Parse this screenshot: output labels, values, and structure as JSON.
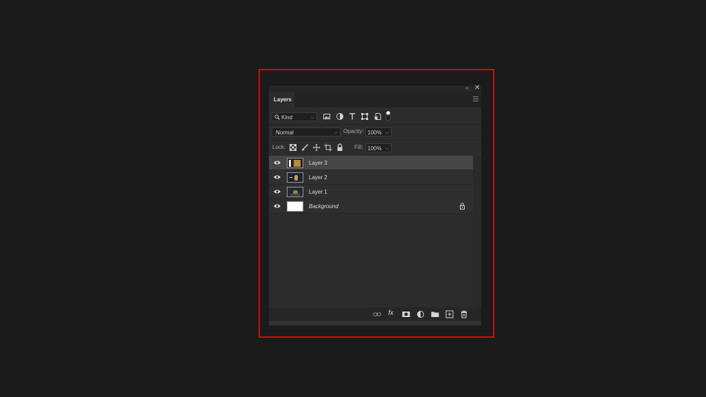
{
  "panel": {
    "tab_label": "Layers",
    "topbar": {
      "collapse_icon": "double-chevron-icon",
      "close_icon": "close-icon",
      "close_glyph": "✕",
      "collapse_glyph": "‹‹"
    }
  },
  "filter": {
    "kind_label": "Kind",
    "icons": [
      "pixel-filter-icon",
      "adjustment-filter-icon",
      "type-filter-icon",
      "shape-filter-icon",
      "smart-object-filter-icon",
      "filter-toggle-icon"
    ]
  },
  "blend": {
    "mode": "Normal",
    "opacity_label": "Opacity:",
    "opacity_value": "100%"
  },
  "lock": {
    "label": "Lock:",
    "icons": [
      "lock-transparent-pixels-icon",
      "lock-image-pixels-icon",
      "lock-position-icon",
      "lock-artboard-icon",
      "lock-all-icon"
    ],
    "fill_label": "Fill:",
    "fill_value": "100%"
  },
  "layers": [
    {
      "name": "Layer 3",
      "selected": true
    },
    {
      "name": "Layer 2",
      "selected": false
    },
    {
      "name": "Layer 1",
      "selected": false
    },
    {
      "name": "Background",
      "selected": false,
      "locked": true
    }
  ],
  "bottom_icons": [
    "link-layers-icon",
    "fx-icon",
    "add-mask-icon",
    "adjustment-layer-icon",
    "new-group-icon",
    "new-layer-icon",
    "delete-icon"
  ],
  "fx_label": "fx",
  "colors": {
    "highlight": "#d40c0c",
    "panel": "#2c2c2c",
    "selected_row": "#464646"
  }
}
